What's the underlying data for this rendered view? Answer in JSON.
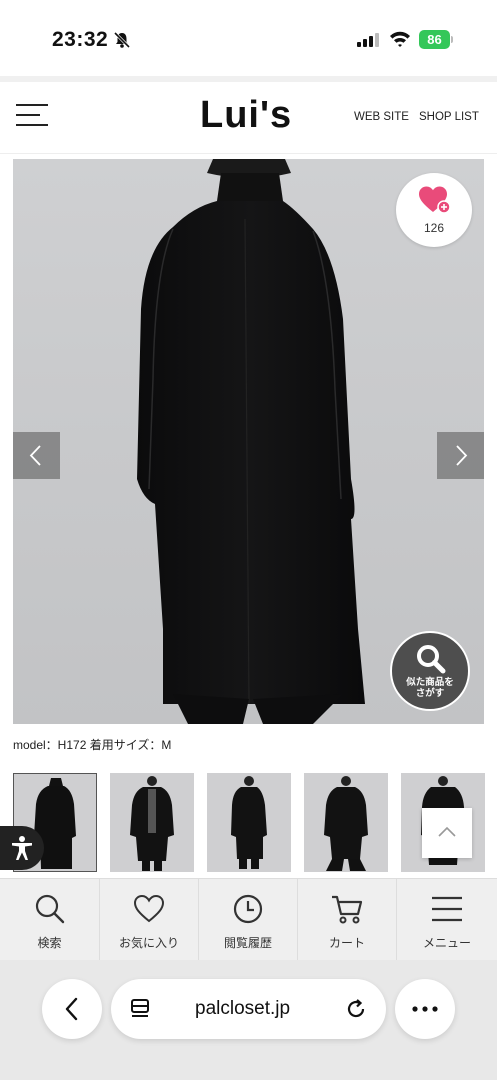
{
  "status_bar": {
    "time": "23:32",
    "battery": "86"
  },
  "header": {
    "logo": "Lui's",
    "links": [
      "WEB SITE",
      "SHOP LIST"
    ]
  },
  "product": {
    "favorite_count": "126",
    "similar_button": [
      "似た商品を",
      "さがす"
    ],
    "model_info": "model：H172 着用サイズ：M",
    "thumbnail_count": 5
  },
  "bottom_nav": [
    {
      "label": "検索",
      "icon": "search-icon"
    },
    {
      "label": "お気に入り",
      "icon": "heart-icon"
    },
    {
      "label": "閲覧履歴",
      "icon": "clock-icon"
    },
    {
      "label": "カート",
      "icon": "cart-icon"
    },
    {
      "label": "メニュー",
      "icon": "menu-icon"
    }
  ],
  "browser": {
    "url": "palcloset.jp"
  },
  "colors": {
    "accent": "#e94b7a",
    "battery": "#34c759"
  }
}
